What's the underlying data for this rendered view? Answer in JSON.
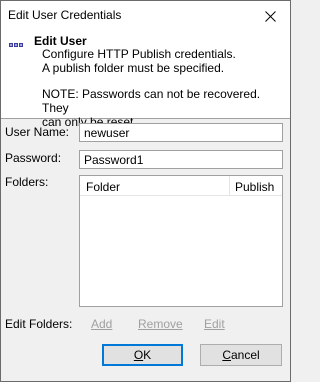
{
  "window": {
    "title": "Edit User Credentials"
  },
  "header": {
    "title": "Edit User",
    "description_line1": "Configure HTTP Publish credentials.",
    "description_line2": "A publish folder must be specified.",
    "note_line1": "NOTE: Passwords can not be recovered. They",
    "note_line2": "can only be reset."
  },
  "form": {
    "username_label": "User Name:",
    "username_value": "newuser",
    "password_label": "Password:",
    "password_value": "Password1",
    "folders_label": "Folders:"
  },
  "folders_table": {
    "columns": [
      "Folder",
      "Publish"
    ],
    "rows": []
  },
  "edit_folders": {
    "label": "Edit Folders:",
    "add_label": "Add",
    "remove_label": "Remove",
    "edit_label": "Edit"
  },
  "buttons": {
    "ok_accel": "O",
    "ok_rest": "K",
    "cancel_accel": "C",
    "cancel_rest": "ancel"
  },
  "icons": {
    "close": "close-icon",
    "header": "user-credentials-icon"
  },
  "colors": {
    "accent": "#0078d7",
    "disabled_text": "#a0a0a0",
    "icon_blue": "#3c3c9c"
  }
}
